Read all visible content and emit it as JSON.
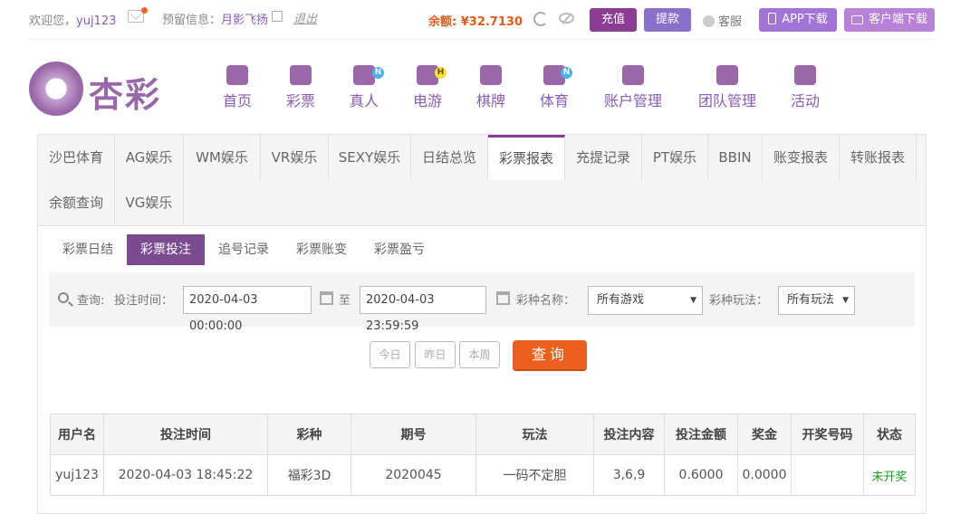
{
  "topbar": {
    "welcome_prefix": "欢迎您，",
    "username": "yuj123",
    "reserve_prefix": "预留信息：",
    "reserve_value": "月影飞扬",
    "logout": "退出",
    "balance_label": "余额:",
    "balance_value": "¥32.7130",
    "recharge": "充值",
    "withdraw": "提款",
    "service": "客服",
    "app_download": "APP下载",
    "client_download": "客户端下载",
    "icons": [
      "mail-icon",
      "edit-icon",
      "refresh-icon",
      "eye-off-icon",
      "headset-icon",
      "phone-icon",
      "monitor-icon"
    ]
  },
  "logo": {
    "text": "杏彩"
  },
  "nav": [
    {
      "label": "首页",
      "icon": "home-icon",
      "badge": ""
    },
    {
      "label": "彩票",
      "icon": "lottery-icon",
      "badge": ""
    },
    {
      "label": "真人",
      "icon": "live-dealer-icon",
      "badge": "N"
    },
    {
      "label": "电游",
      "icon": "gamepad-icon",
      "badge": "H"
    },
    {
      "label": "棋牌",
      "icon": "cards-icon",
      "badge": ""
    },
    {
      "label": "体育",
      "icon": "trophy-icon",
      "badge": "N"
    },
    {
      "label": "账户管理",
      "icon": "account-icon",
      "badge": ""
    },
    {
      "label": "团队管理",
      "icon": "team-icon",
      "badge": ""
    },
    {
      "label": "活动",
      "icon": "gift-icon",
      "badge": ""
    }
  ],
  "tabs": [
    "沙巴体育",
    "AG娱乐",
    "WM娱乐",
    "VR娱乐",
    "SEXY娱乐",
    "日结总览",
    "彩票报表",
    "充提记录",
    "PT娱乐",
    "BBIN",
    "账变报表",
    "转账报表",
    "余额查询",
    "VG娱乐"
  ],
  "active_tab": "彩票报表",
  "subtabs": [
    "彩票日结",
    "彩票投注",
    "追号记录",
    "彩票账变",
    "彩票盈亏"
  ],
  "active_subtab": "彩票投注",
  "filter": {
    "query_label": "查询:",
    "time_label": "投注时间：",
    "start_time": "2020-04-03 00:00:00",
    "to": "至",
    "end_time": "2020-04-03 23:59:59",
    "game_label": "彩种名称：",
    "game_value": "所有游戏",
    "play_label": "彩种玩法：",
    "play_value": "所有玩法",
    "today": "今日",
    "yesterday": "昨日",
    "this_week": "本周",
    "query_button": "查询"
  },
  "table": {
    "headers": [
      "用户名",
      "投注时间",
      "彩种",
      "期号",
      "玩法",
      "投注内容",
      "投注金额",
      "奖金",
      "开奖号码",
      "状态"
    ],
    "rows": [
      [
        "yuj123",
        "2020-04-03 18:45:22",
        "福彩3D",
        "2020045",
        "一码不定胆",
        "3,6,9",
        "0.6000",
        "0.0000",
        "",
        "未开奖"
      ]
    ]
  },
  "colors": {
    "accent": "#8a3d93",
    "balance": "#e25a1c",
    "query": "#eb5f1f",
    "status_pending": "#1f9a1f"
  }
}
